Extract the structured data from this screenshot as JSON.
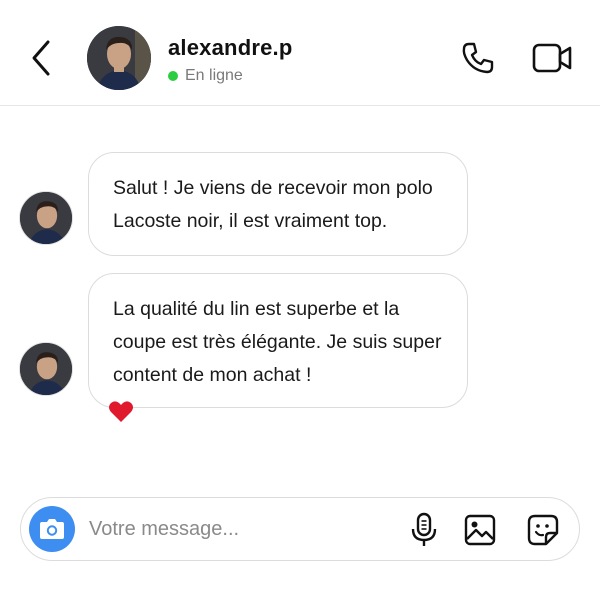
{
  "header": {
    "username": "alexandre.p",
    "status_text": "En ligne",
    "status_color": "#2ecc40",
    "back_icon": "chevron-left-icon",
    "call_icon": "phone-icon",
    "video_icon": "video-camera-icon"
  },
  "messages": [
    {
      "sender": "alexandre.p",
      "text": "Salut ! Je viens de recevoir mon polo Lacoste noir, il est vraiment top."
    },
    {
      "sender": "alexandre.p",
      "text": "La qualité du lin est superbe et la coupe est très élégante. Je suis super content de mon achat !",
      "reaction": "❤️"
    }
  ],
  "composer": {
    "placeholder": "Votre message...",
    "camera_icon": "camera-icon",
    "camera_color": "#3d8ef0",
    "mic_icon": "microphone-icon",
    "image_icon": "image-icon",
    "sticker_icon": "sticker-icon"
  }
}
